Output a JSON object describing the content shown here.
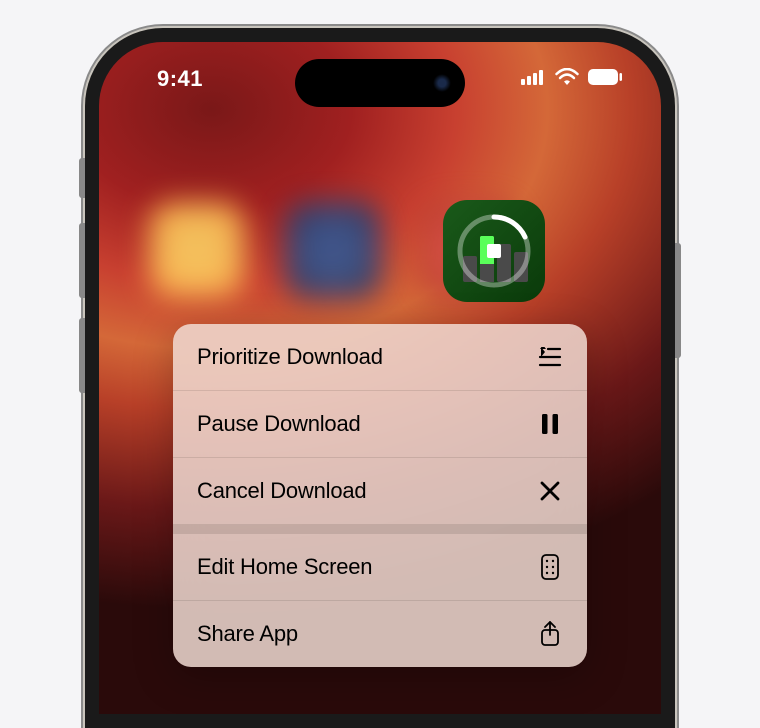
{
  "statusBar": {
    "time": "9:41"
  },
  "appIcon": {
    "name": "numbers-app-downloading"
  },
  "contextMenu": {
    "items": [
      {
        "label": "Prioritize Download",
        "icon": "prioritize"
      },
      {
        "label": "Pause Download",
        "icon": "pause"
      },
      {
        "label": "Cancel Download",
        "icon": "cancel"
      },
      {
        "label": "Edit Home Screen",
        "icon": "apps-grid"
      },
      {
        "label": "Share App",
        "icon": "share"
      }
    ]
  }
}
